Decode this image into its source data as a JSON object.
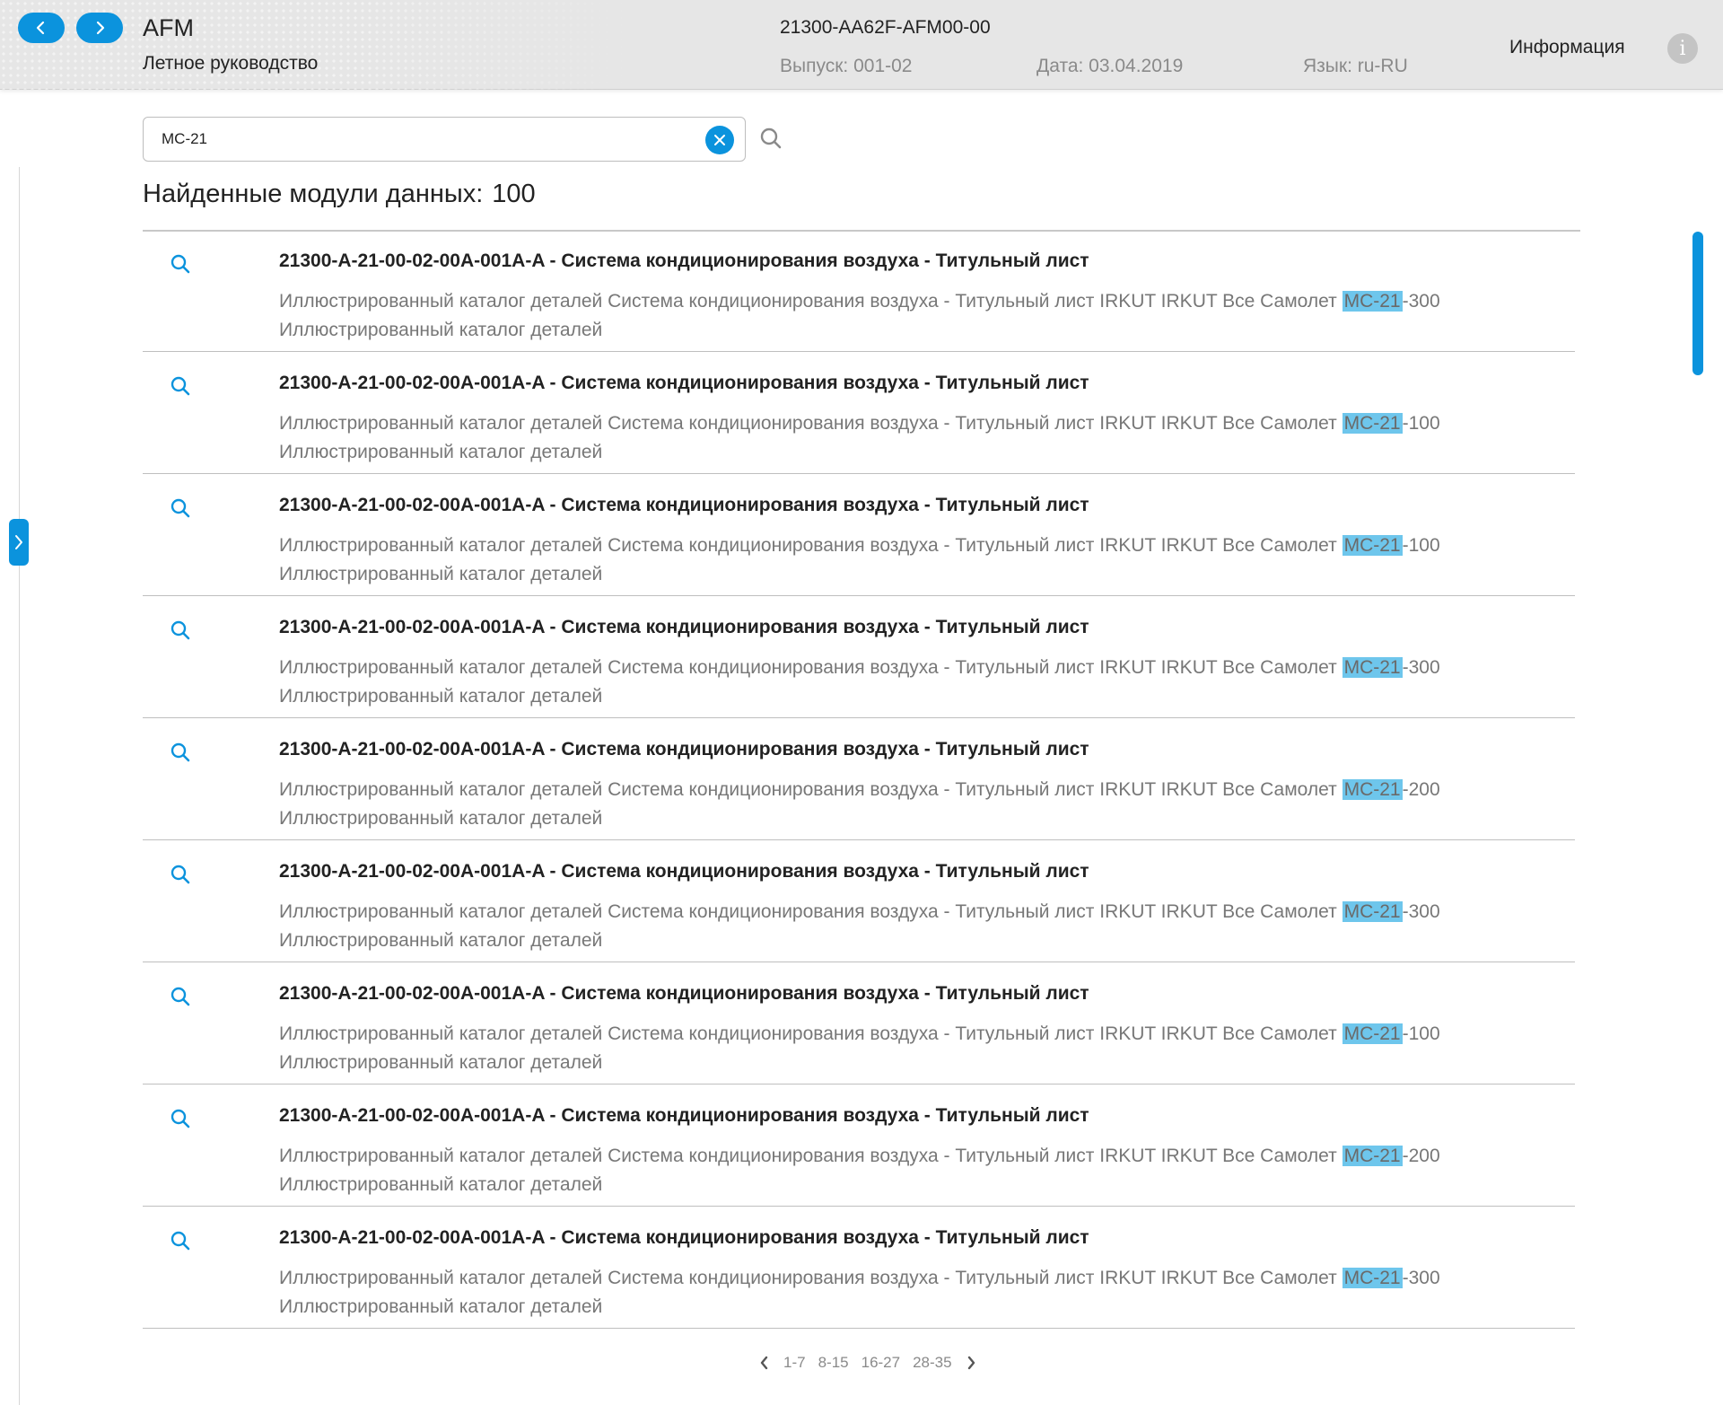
{
  "header": {
    "app_title": "AFM",
    "app_subtitle": "Летное руководство",
    "doc_code": "21300-AA62F-AFM00-00",
    "issue": "Выпуск: 001-02",
    "date": "Дата: 03.04.2019",
    "language": "Язык: ru-RU",
    "info_label": "Информация",
    "info_icon": "i"
  },
  "search": {
    "value": "МС-21"
  },
  "results_header": {
    "label": "Найденные модули данных:",
    "count": "100"
  },
  "results": [
    {
      "title": "21300-A-21-00-02-00A-001A-A - Система кондиционирования воздуха - Титульный лист",
      "desc_prefix": "Иллюстрированный каталог деталей Система кондиционирования воздуха - Титульный лист IRKUT IRKUT Все Самолет ",
      "highlight": "МС-21",
      "desc_suffix": "-300",
      "desc_line2": "Иллюстрированный каталог деталей"
    },
    {
      "title": "21300-A-21-00-02-00A-001A-A - Система кондиционирования воздуха - Титульный лист",
      "desc_prefix": "Иллюстрированный каталог деталей Система кондиционирования воздуха - Титульный лист IRKUT IRKUT Все Самолет ",
      "highlight": "МС-21",
      "desc_suffix": "-100",
      "desc_line2": "Иллюстрированный каталог деталей"
    },
    {
      "title": "21300-A-21-00-02-00A-001A-A - Система кондиционирования воздуха - Титульный лист",
      "desc_prefix": "Иллюстрированный каталог деталей Система кондиционирования воздуха - Титульный лист IRKUT IRKUT Все Самолет ",
      "highlight": "МС-21",
      "desc_suffix": "-100",
      "desc_line2": "Иллюстрированный каталог деталей"
    },
    {
      "title": "21300-A-21-00-02-00A-001A-A - Система кондиционирования воздуха - Титульный лист",
      "desc_prefix": "Иллюстрированный каталог деталей Система кондиционирования воздуха - Титульный лист IRKUT IRKUT Все Самолет ",
      "highlight": "МС-21",
      "desc_suffix": "-300",
      "desc_line2": "Иллюстрированный каталог деталей"
    },
    {
      "title": "21300-A-21-00-02-00A-001A-A - Система кондиционирования воздуха - Титульный лист",
      "desc_prefix": "Иллюстрированный каталог деталей Система кондиционирования воздуха - Титульный лист IRKUT IRKUT Все Самолет ",
      "highlight": "МС-21",
      "desc_suffix": "-200",
      "desc_line2": "Иллюстрированный каталог деталей"
    },
    {
      "title": "21300-A-21-00-02-00A-001A-A - Система кондиционирования воздуха - Титульный лист",
      "desc_prefix": "Иллюстрированный каталог деталей Система кондиционирования воздуха - Титульный лист IRKUT IRKUT Все Самолет ",
      "highlight": "МС-21",
      "desc_suffix": "-300",
      "desc_line2": "Иллюстрированный каталог деталей"
    },
    {
      "title": "21300-A-21-00-02-00A-001A-A - Система кондиционирования воздуха - Титульный лист",
      "desc_prefix": "Иллюстрированный каталог деталей Система кондиционирования воздуха - Титульный лист IRKUT IRKUT Все Самолет ",
      "highlight": "МС-21",
      "desc_suffix": "-100",
      "desc_line2": "Иллюстрированный каталог деталей"
    },
    {
      "title": "21300-A-21-00-02-00A-001A-A - Система кондиционирования воздуха - Титульный лист",
      "desc_prefix": "Иллюстрированный каталог деталей Система кондиционирования воздуха - Титульный лист IRKUT IRKUT Все Самолет ",
      "highlight": "МС-21",
      "desc_suffix": "-200",
      "desc_line2": "Иллюстрированный каталог деталей"
    },
    {
      "title": "21300-A-21-00-02-00A-001A-A - Система кондиционирования воздуха - Титульный лист",
      "desc_prefix": "Иллюстрированный каталог деталей Система кондиционирования воздуха - Титульный лист IRKUT IRKUT Все Самолет ",
      "highlight": "МС-21",
      "desc_suffix": "-300",
      "desc_line2": "Иллюстрированный каталог деталей"
    }
  ],
  "pagination": {
    "pages": [
      "1-7",
      "8-15",
      "16-27",
      "28-35"
    ]
  },
  "icons": {
    "nav_back": "chevron-left-icon",
    "nav_forward": "chevron-right-icon",
    "clear": "close-icon",
    "search": "search-icon",
    "result": "search-icon",
    "sidebar_toggle": "chevron-right-icon",
    "info": "info-icon"
  },
  "colors": {
    "accent": "#0b93dd",
    "highlight": "#6ec6ec",
    "header_bg": "#e6e6e6",
    "muted_text": "#777777"
  }
}
